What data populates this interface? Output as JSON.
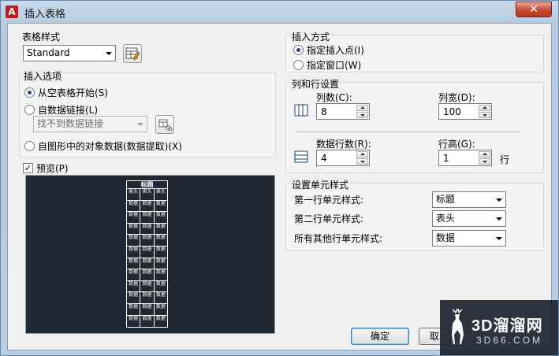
{
  "window": {
    "title": "插入表格",
    "app_icon": "A",
    "close_glyph": "✕"
  },
  "table_style": {
    "label": "表格样式",
    "value": "Standard",
    "icon": "table-style-dialog-icon"
  },
  "insert_options": {
    "label": "插入选项",
    "from_empty": "从空表格开始(S)",
    "from_data_link": "自数据链接(L)",
    "data_link_value": "找不到数据链接",
    "from_object_data": "自图形中的对象数据(数据提取)(X)"
  },
  "preview": {
    "label": "预览(P)",
    "checked": true,
    "table_title": "标题",
    "header_cell": "表头",
    "data_cell": "数据"
  },
  "insert_method": {
    "label": "插入方式",
    "specify_point": "指定插入点(I)",
    "specify_window": "指定窗口(W)"
  },
  "rows_cols": {
    "label": "列和行设置",
    "columns_label": "列数(C):",
    "columns_value": "8",
    "col_width_label": "列宽(D):",
    "col_width_value": "100",
    "data_rows_label": "数据行数(R):",
    "data_rows_value": "4",
    "row_height_label": "行高(G):",
    "row_height_value": "1",
    "row_unit": "行"
  },
  "cell_styles": {
    "label": "设置单元样式",
    "first_row_label": "第一行单元样式:",
    "first_row_value": "标题",
    "second_row_label": "第二行单元样式:",
    "second_row_value": "表头",
    "other_rows_label": "所有其他行单元样式:",
    "other_rows_value": "数据"
  },
  "buttons": {
    "ok": "确定",
    "cancel": "取"
  },
  "watermark": {
    "main": "3D溜溜网",
    "sub": "3D66.COM"
  },
  "colors": {
    "preview_bg": "#222833",
    "close_red": "#c7472f",
    "accent_blue": "#1a4e8e"
  }
}
